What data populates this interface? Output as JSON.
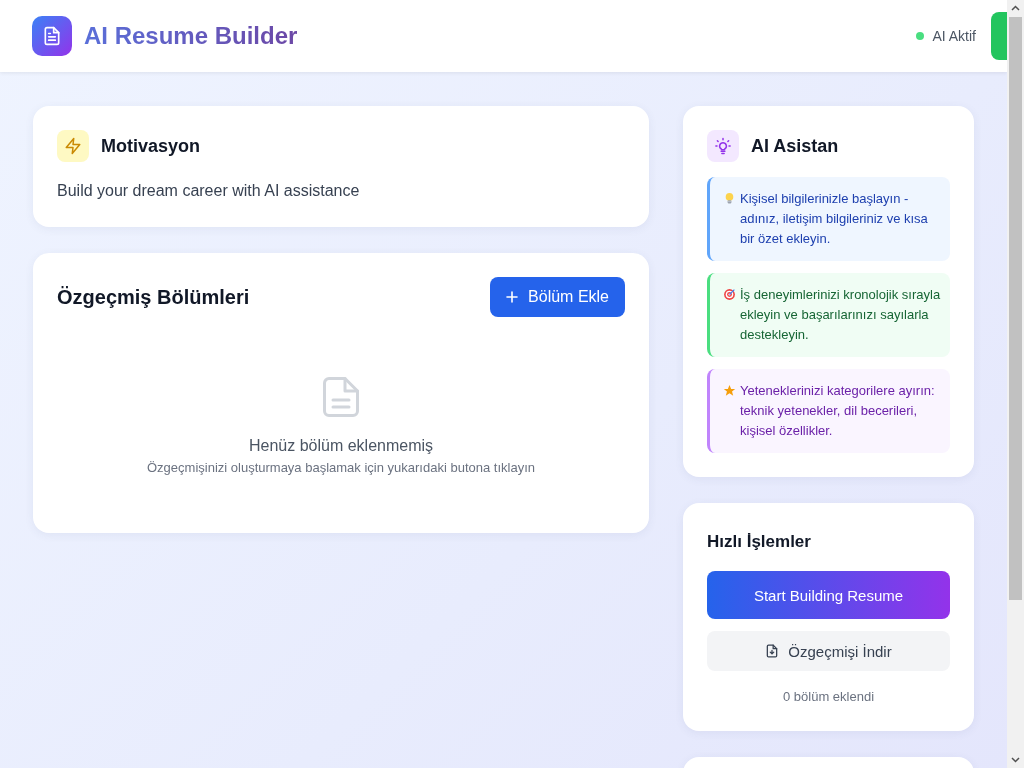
{
  "header": {
    "title": "AI Resume Builder",
    "status": {
      "label": "AI Aktif",
      "on": true
    }
  },
  "motivation_card": {
    "title": "Motivasyon",
    "text": "Build your dream career with AI assistance"
  },
  "sections_card": {
    "title": "Özgeçmiş Bölümleri",
    "add_button": "Bölüm Ekle",
    "empty_state": {
      "title": "Henüz bölüm eklenmemiş",
      "hint": "Özgeçmişinizi oluşturmaya başlamak için yukarıdaki butona tıklayın"
    }
  },
  "assistant_card": {
    "title": "AI Asistan",
    "tips": [
      {
        "kind": "idea",
        "text": "Kişisel bilgilerinizle başlayın - adınız, iletişim bilgileriniz ve kısa bir özet ekleyin."
      },
      {
        "kind": "goal",
        "text": "İş deneyimlerinizi kronolojik sırayla ekleyin ve başarılarınızı sayılarla destekleyin."
      },
      {
        "kind": "skill",
        "text": "Yeteneklerinizi kategorilere ayırın: teknik yetenekler, dil becerileri, kişisel özellikler."
      }
    ]
  },
  "quick_actions": {
    "title": "Hızlı İşlemler",
    "primary_button": "Start Building Resume",
    "download_button": "Özgeçmişi İndir",
    "count": "0 bölüm eklendi"
  }
}
